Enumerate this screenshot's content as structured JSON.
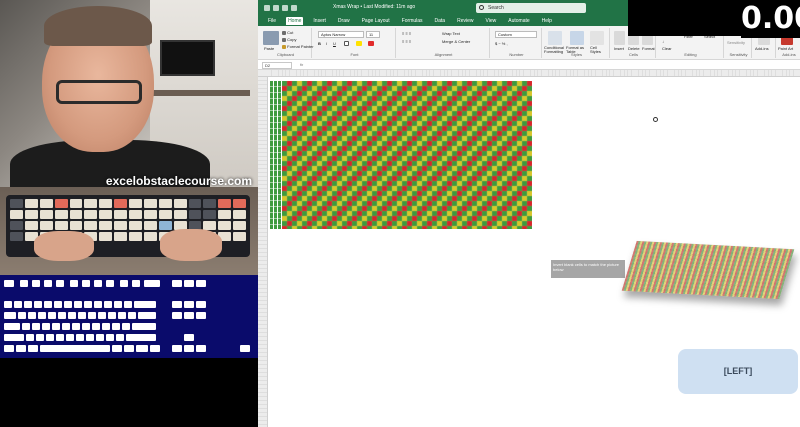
{
  "overlay": {
    "brand": "excelobstaclecourse.com",
    "timer": "0.00",
    "direction_label": "[LEFT]"
  },
  "excel": {
    "title": "Xmas Wrap • Last Modified: 11m ago",
    "search_placeholder": "Search",
    "tabs": [
      "File",
      "Home",
      "Insert",
      "Draw",
      "Page Layout",
      "Formulas",
      "Data",
      "Review",
      "View",
      "Automate",
      "Help"
    ],
    "active_tab": "Home",
    "ribbon": {
      "clipboard": {
        "label": "Clipboard",
        "paste": "Paste",
        "cut": "Cut",
        "copy": "Copy",
        "format_painter": "Format Painter"
      },
      "font": {
        "label": "Font",
        "name": "Aptos Narrow",
        "size": "11"
      },
      "alignment": {
        "label": "Alignment",
        "wrap": "Wrap Text",
        "merge": "Merge & Center"
      },
      "number": {
        "label": "Number",
        "format": "Custom"
      },
      "styles": {
        "label": "Styles",
        "conditional": "Conditional Formatting",
        "format_table": "Format as Table",
        "cell_styles": "Cell Styles"
      },
      "cells": {
        "label": "Cells",
        "insert": "Insert",
        "delete": "Delete",
        "format": "Format"
      },
      "editing": {
        "label": "Editing",
        "sort": "Sort & Filter",
        "find": "Find & Select",
        "clear": "Clear"
      },
      "sensitivity": {
        "label": "Sensitivity",
        "btn": "Sensitivity"
      },
      "addins": {
        "label": "Add-ins",
        "btn": "Add-ins"
      },
      "copilot": {
        "label": "Add-ins",
        "btn": "Paint Art"
      }
    },
    "name_box": "D2",
    "fx_label": "fx",
    "instruction_text": "Invert blank cells to match the picture below",
    "checker": {
      "colors": [
        "#d8262a",
        "#3e9a3e",
        "#d9c52a"
      ]
    }
  }
}
